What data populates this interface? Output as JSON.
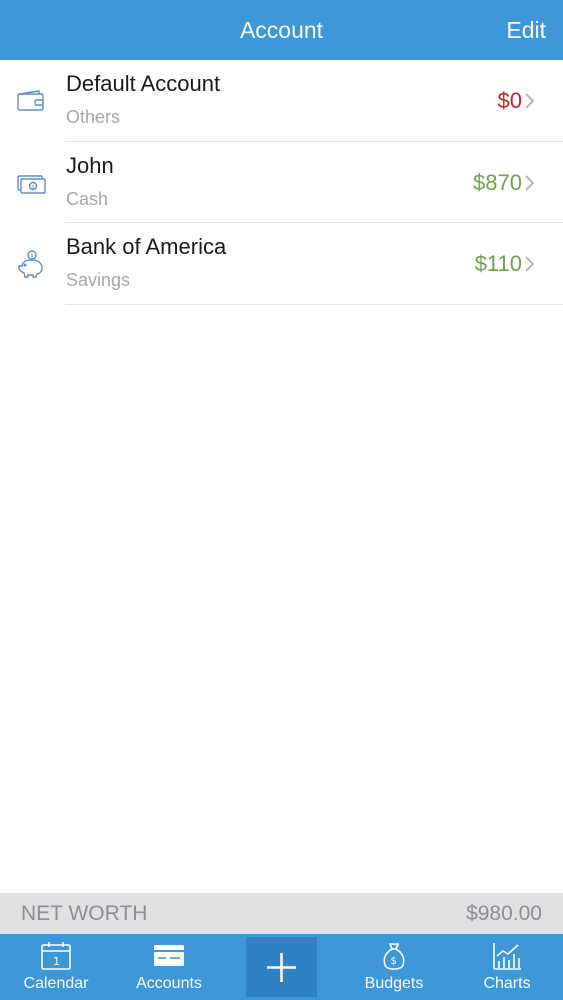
{
  "header": {
    "title": "Account",
    "edit_label": "Edit"
  },
  "accounts": [
    {
      "name": "Default Account",
      "type": "Others",
      "amount": "$0",
      "icon": "wallet-icon",
      "status": "negative"
    },
    {
      "name": "John",
      "type": "Cash",
      "amount": "$870",
      "icon": "cash-icon",
      "status": "positive"
    },
    {
      "name": "Bank of America",
      "type": "Savings",
      "amount": "$110",
      "icon": "piggy-bank-icon",
      "status": "positive"
    }
  ],
  "net_worth": {
    "label": "NET WORTH",
    "value": "$980.00"
  },
  "tabbar": {
    "calendar": "Calendar",
    "accounts": "Accounts",
    "budgets": "Budgets",
    "charts": "Charts",
    "calendar_day": "1"
  },
  "colors": {
    "accent": "#3d97d9",
    "negative": "#cc1f1f",
    "positive": "#6fa24a"
  }
}
